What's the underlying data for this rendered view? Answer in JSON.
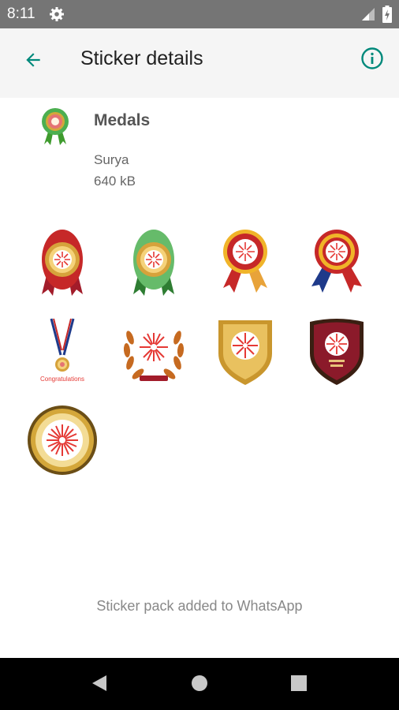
{
  "status_bar": {
    "time": "8:11",
    "icons": [
      "gear-icon",
      "signal-icon",
      "battery-icon"
    ]
  },
  "app_bar": {
    "title": "Sticker details",
    "back_icon": "arrow-back-icon",
    "info_icon": "info-icon"
  },
  "pack": {
    "name": "Medals",
    "author": "Surya",
    "size": "640 kB"
  },
  "stickers": [
    {
      "name": "red-rosette-medal"
    },
    {
      "name": "green-rosette-medal"
    },
    {
      "name": "red-ribbon-rosette"
    },
    {
      "name": "blue-ribbon-rosette"
    },
    {
      "name": "neck-medal",
      "caption": "Congratulations"
    },
    {
      "name": "laurel-wreath-badge"
    },
    {
      "name": "gold-shield-badge"
    },
    {
      "name": "maroon-shield-badge"
    },
    {
      "name": "gold-round-medal"
    }
  ],
  "footer": {
    "message": "Sticker pack added to WhatsApp"
  },
  "nav_bar": {
    "buttons": [
      "back-triangle-icon",
      "home-circle-icon",
      "recents-square-icon"
    ]
  },
  "colors": {
    "accent": "#00897b",
    "status_bar": "#757575",
    "app_bar": "#f5f5f5",
    "nav_bar": "#000000"
  }
}
